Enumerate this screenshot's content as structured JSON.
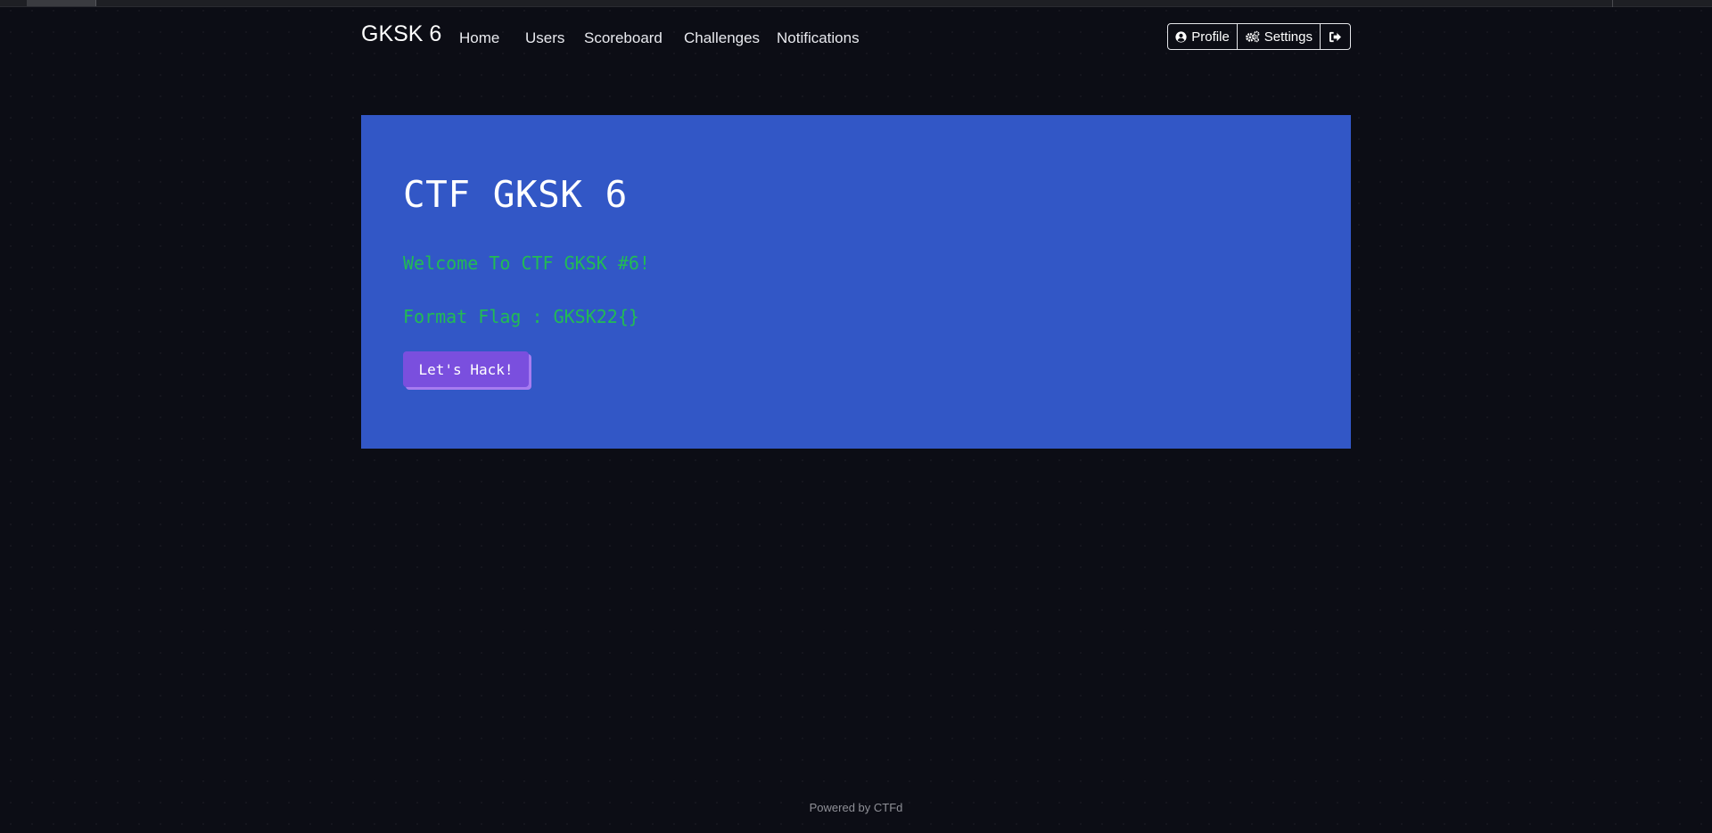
{
  "navbar": {
    "brand": "GKSK 6",
    "links": [
      {
        "label": "Home"
      },
      {
        "label": "Users"
      },
      {
        "label": "Scoreboard"
      },
      {
        "label": "Challenges"
      },
      {
        "label": "Notifications"
      }
    ],
    "profile_label": "Profile",
    "settings_label": "Settings",
    "logout_icon": "sign-out-icon"
  },
  "hero": {
    "title": "CTF GKSK 6",
    "welcome": "Welcome To CTF GKSK #6!",
    "flag_format": "Format Flag : GKSK22{}",
    "button_label": "Let's Hack!"
  },
  "footer": {
    "text": "Powered by CTFd"
  },
  "colors": {
    "background": "#0c0d15",
    "hero_background": "#3257c6",
    "hero_text_green": "#22bb54",
    "button_purple": "#7a4fde"
  }
}
